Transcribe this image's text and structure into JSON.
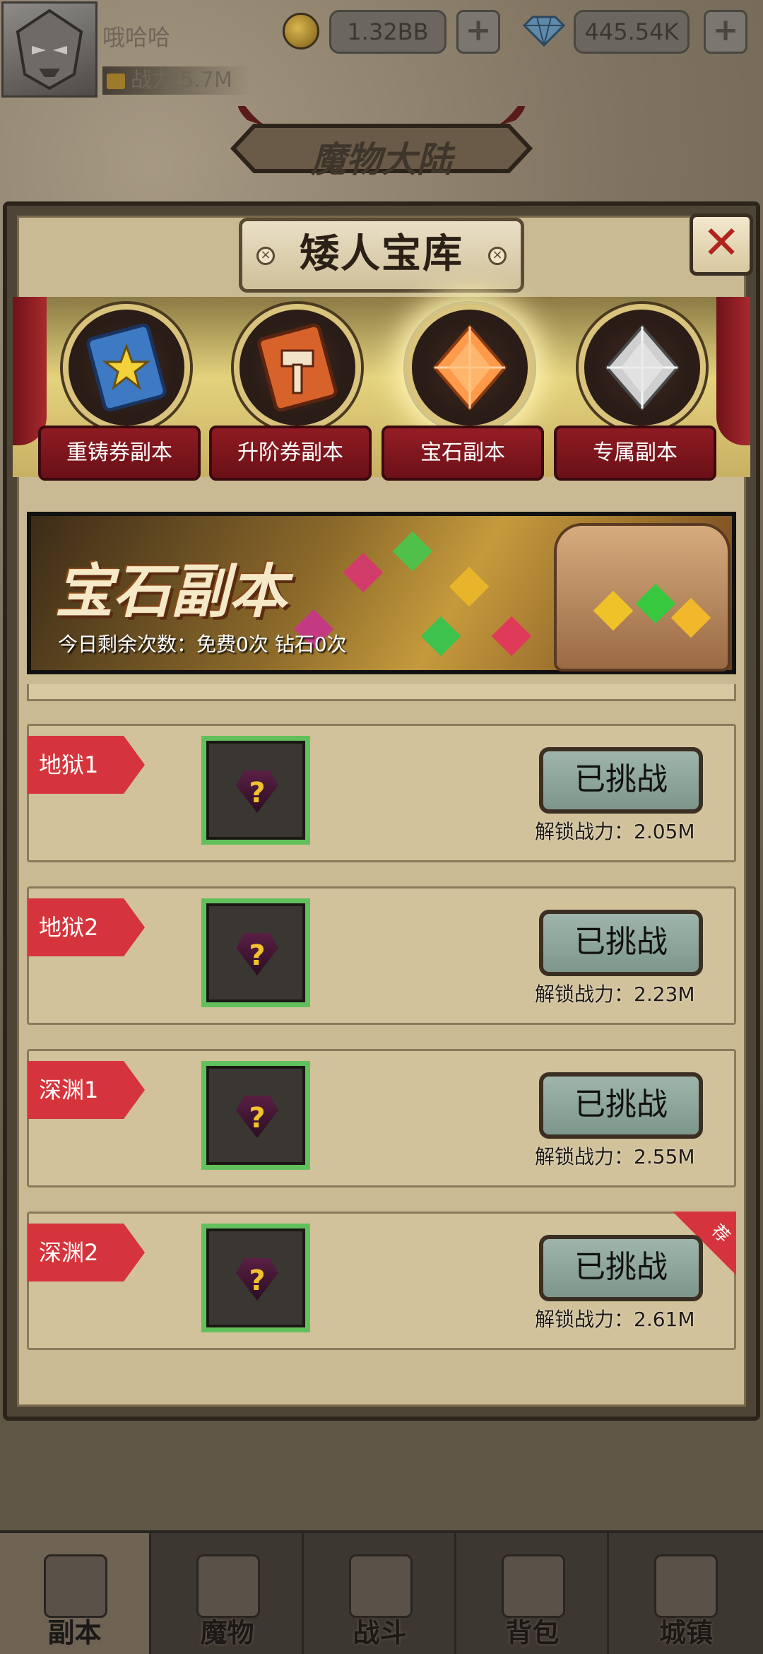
{
  "player": {
    "name": "哦哈哈",
    "power_label": "战力:5.7M"
  },
  "currency": {
    "gold": "1.32BB",
    "diamonds": "445.54K",
    "plus": "+"
  },
  "map_title": "魔物大陆",
  "dialog": {
    "title": "矮人宝库",
    "close": "✕"
  },
  "tabs": [
    {
      "label": "重铸券副本",
      "icon": "star-ticket-icon"
    },
    {
      "label": "升阶券副本",
      "icon": "hammer-ticket-icon"
    },
    {
      "label": "宝石副本",
      "icon": "orange-gem-icon"
    },
    {
      "label": "专属副本",
      "icon": "silver-gem-icon"
    }
  ],
  "active_tab": 2,
  "banner": {
    "title": "宝石副本",
    "remaining": "今日剩余次数：免费0次 钻石0次"
  },
  "dungeons": [
    {
      "name": "地狱1",
      "button": "已挑战",
      "req": "解锁战力：2.05M",
      "recommended": false
    },
    {
      "name": "地狱2",
      "button": "已挑战",
      "req": "解锁战力：2.23M",
      "recommended": false
    },
    {
      "name": "深渊1",
      "button": "已挑战",
      "req": "解锁战力：2.55M",
      "recommended": false
    },
    {
      "name": "深渊2",
      "button": "已挑战",
      "req": "解锁战力：2.61M",
      "recommended": true
    }
  ],
  "rec_badge": "荐",
  "reward_mark": "?",
  "nav": [
    {
      "label": "副本",
      "icon": "map-scroll-icon"
    },
    {
      "label": "魔物",
      "icon": "helmet-icon"
    },
    {
      "label": "战斗",
      "icon": "crossed-swords-icon"
    },
    {
      "label": "背包",
      "icon": "backpack-icon"
    },
    {
      "label": "城镇",
      "icon": "shop-building-icon"
    }
  ],
  "colors": {
    "ribbon": "#d6343c",
    "slot_border": "#62c05c",
    "tab_red": "#8f1b22"
  }
}
